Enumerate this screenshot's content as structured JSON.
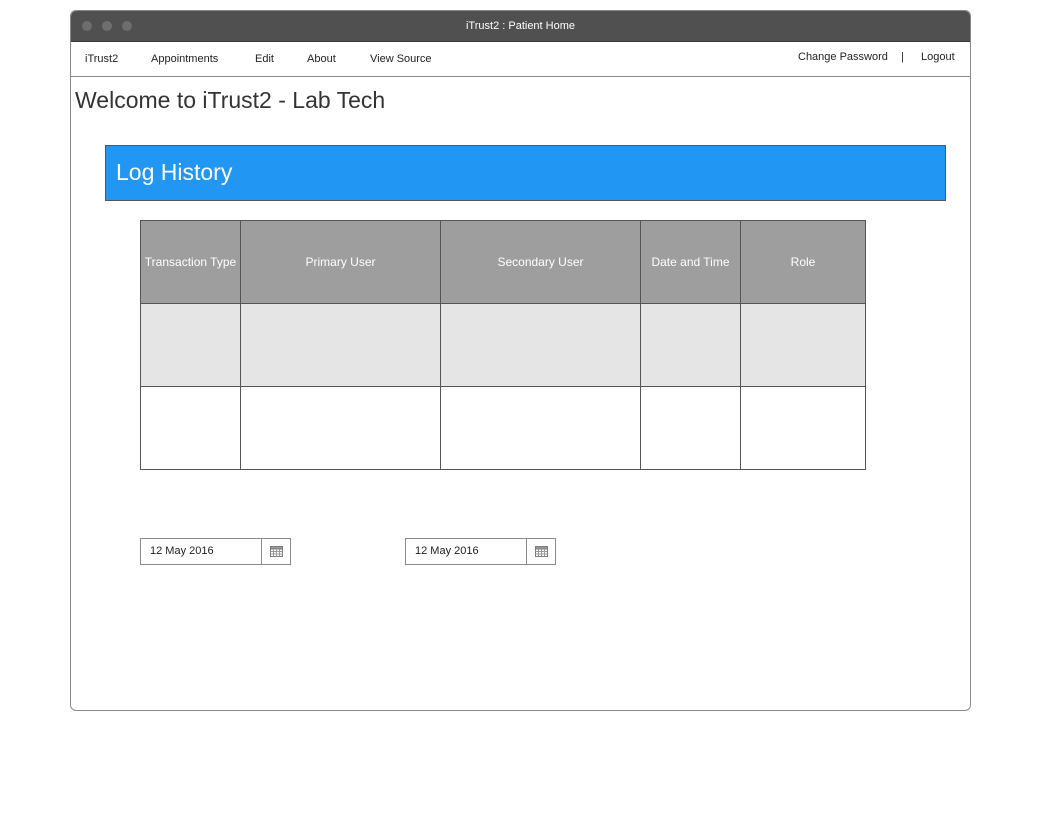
{
  "window": {
    "title": "iTrust2 : Patient Home"
  },
  "navbar": {
    "items": [
      {
        "label": "iTrust2"
      },
      {
        "label": "Appointments"
      },
      {
        "label": "Edit"
      },
      {
        "label": "About"
      },
      {
        "label": "View Source"
      }
    ],
    "change_password": "Change Password",
    "separator": "|",
    "logout": "Logout"
  },
  "page": {
    "title": "Welcome to iTrust2 - Lab Tech"
  },
  "log_history": {
    "title": "Log History",
    "columns": [
      "Transaction Type",
      "Primary User",
      "Secondary User",
      "Date and Time",
      "Role"
    ],
    "rows": [
      [
        "",
        "",
        "",
        "",
        ""
      ],
      [
        "",
        "",
        "",
        "",
        ""
      ]
    ]
  },
  "date_range": {
    "start_date": "12 May 2016",
    "end_date": "12 May 2016",
    "icon": "calendar-icon"
  },
  "colors": {
    "header_accent": "#2196f3",
    "table_header": "#9e9e9e",
    "titlebar": "#505050"
  }
}
